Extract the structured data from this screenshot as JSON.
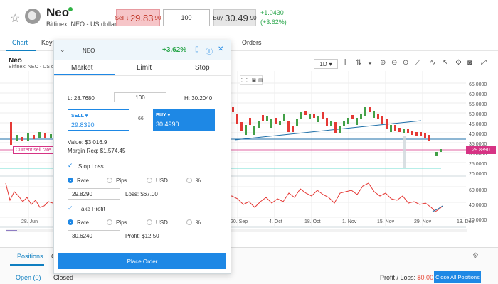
{
  "header": {
    "symbol": "Neo",
    "subtitle": "Bitfinex: NEO - US dollar",
    "sell_label": "Sell",
    "sell_arrow": "↓",
    "sell_price_main": "29.83",
    "sell_price_small": "90",
    "quantity": "100",
    "buy_label": "Buy",
    "buy_price_main": "30.49",
    "buy_price_small": "90",
    "change_abs": "+1.0430",
    "change_pct": "(+3.62%)"
  },
  "tabs": [
    "Chart",
    "Key",
    "Orders"
  ],
  "chart": {
    "title": "Neo",
    "subtitle": "Bitfinex: NEO - US dol",
    "timeframe": "1D",
    "current_sell_label": "Current sell rate",
    "price_tag": "29.8390",
    "price_axis": [
      "65.0000",
      "60.0000",
      "55.0000",
      "50.0000",
      "45.0000",
      "40.0000",
      "35.0000",
      "30.0000",
      "25.0000",
      "20.0000"
    ],
    "osc_axis": [
      "60.0000",
      "40.0000",
      "20.0000"
    ],
    "dates": [
      "28. Jun",
      "20. Sep",
      "4. Oct",
      "18. Oct",
      "1. Nov",
      "15. Nov",
      "29. Nov",
      "13. Dec"
    ]
  },
  "panel": {
    "symbol": "NEO",
    "change_pct": "+3.62%",
    "tabs": [
      "Market",
      "Limit",
      "Stop"
    ],
    "low": "L: 28.7680",
    "quantity": "100",
    "high": "H: 30.2040",
    "sell_label": "SELL",
    "sell_price": "29.8390",
    "spread": "66",
    "buy_label": "BUY",
    "buy_price": "30.4990",
    "value": "Value: $3,016.9",
    "margin": "Margin Req: $1,574.45",
    "stop_loss": {
      "label": "Stop Loss",
      "options": [
        "Rate",
        "Pips",
        "USD",
        "%"
      ],
      "input": "29.8290",
      "result": "Loss: $67.00"
    },
    "take_profit": {
      "label": "Take Profit",
      "options": [
        "Rate",
        "Pips",
        "USD",
        "%"
      ],
      "input": "30.6240",
      "result": "Profit: $12.50"
    },
    "place_order": "Place Order"
  },
  "bottom": {
    "tab_positions": "Positions",
    "tab_other": "C",
    "open": "Open (0)",
    "closed": "Closed",
    "pl_label": "Profit / Loss:",
    "pl_value": "$0.00",
    "close_all": "Close All Positions"
  }
}
